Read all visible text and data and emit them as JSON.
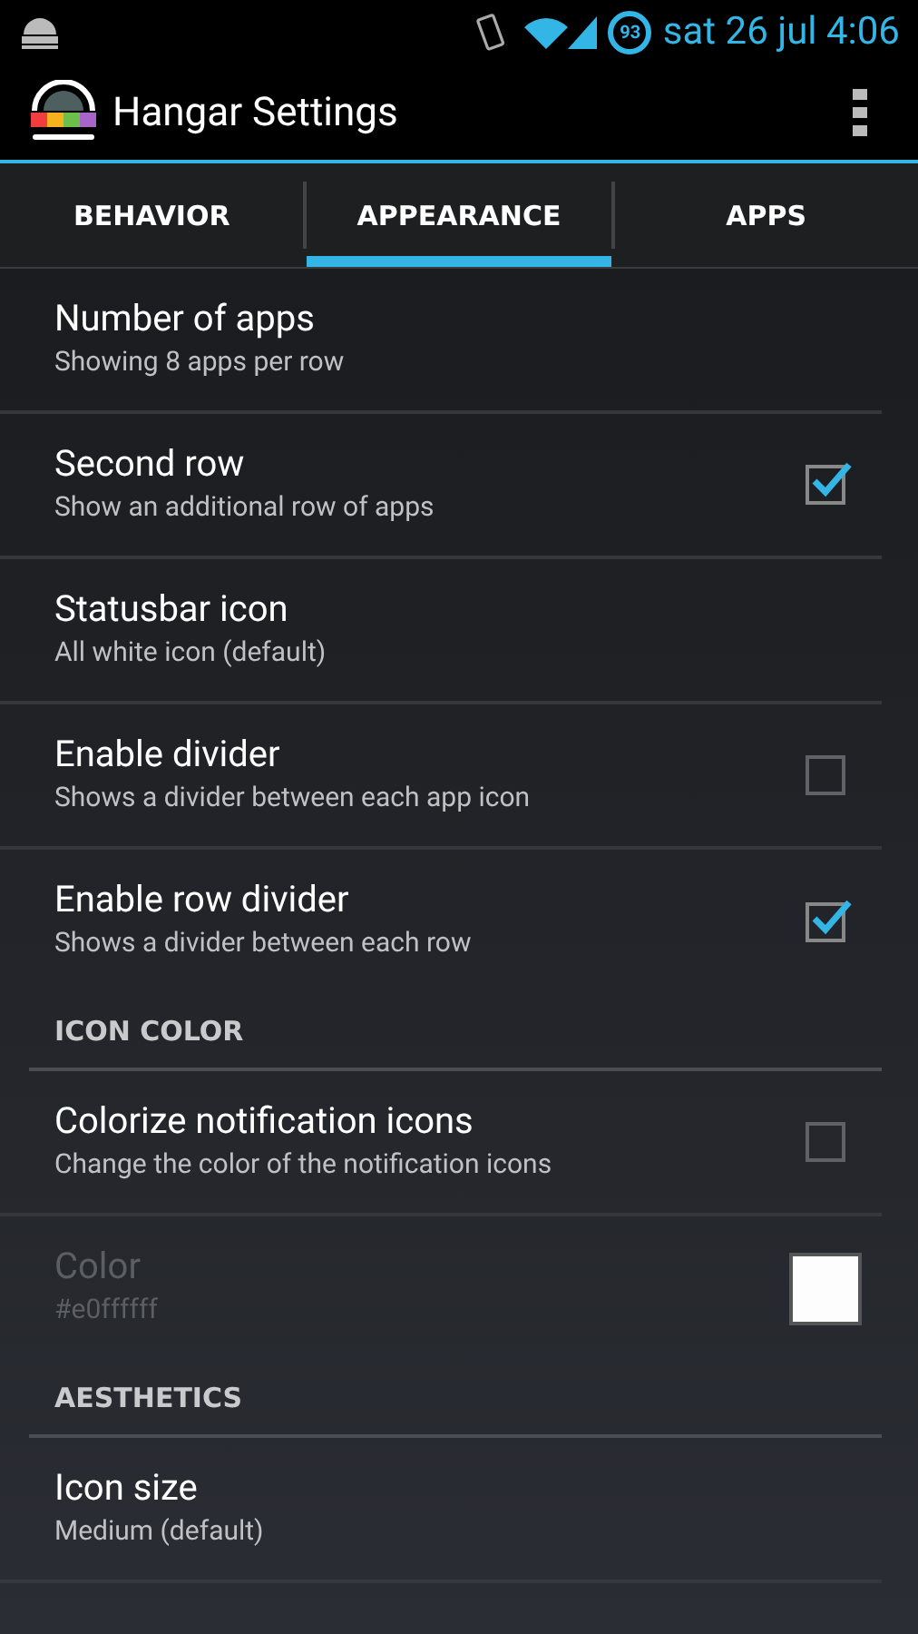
{
  "status_bar": {
    "battery_percent": "93",
    "time": "sat 26 jul 4:06"
  },
  "action_bar": {
    "title": "Hangar Settings"
  },
  "tabs": [
    {
      "label": "BEHAVIOR",
      "selected": false
    },
    {
      "label": "APPEARANCE",
      "selected": true
    },
    {
      "label": "APPS",
      "selected": false
    }
  ],
  "preferences": [
    {
      "kind": "plain",
      "title": "Number of apps",
      "summary": "Showing 8 apps per row",
      "disabled": false
    },
    {
      "kind": "checkbox",
      "title": "Second row",
      "summary": "Show an additional row of apps",
      "checked": true,
      "disabled": false
    },
    {
      "kind": "plain",
      "title": "Statusbar icon",
      "summary": "All white icon (default)",
      "disabled": false
    },
    {
      "kind": "checkbox",
      "title": "Enable divider",
      "summary": "Shows a divider between each app icon",
      "checked": false,
      "disabled": false
    },
    {
      "kind": "checkbox",
      "title": "Enable row divider",
      "summary": "Shows a divider between each row",
      "checked": true,
      "disabled": false
    },
    {
      "kind": "category",
      "title": "ICON COLOR"
    },
    {
      "kind": "checkbox",
      "title": "Colorize notification icons",
      "summary": "Change the color of the notification icons",
      "checked": false,
      "disabled": false
    },
    {
      "kind": "color",
      "title": "Color",
      "summary": "#e0ffffff",
      "disabled": true
    },
    {
      "kind": "category",
      "title": "AESTHETICS"
    },
    {
      "kind": "plain",
      "title": "Icon size",
      "summary": "Medium (default)",
      "disabled": false
    }
  ]
}
